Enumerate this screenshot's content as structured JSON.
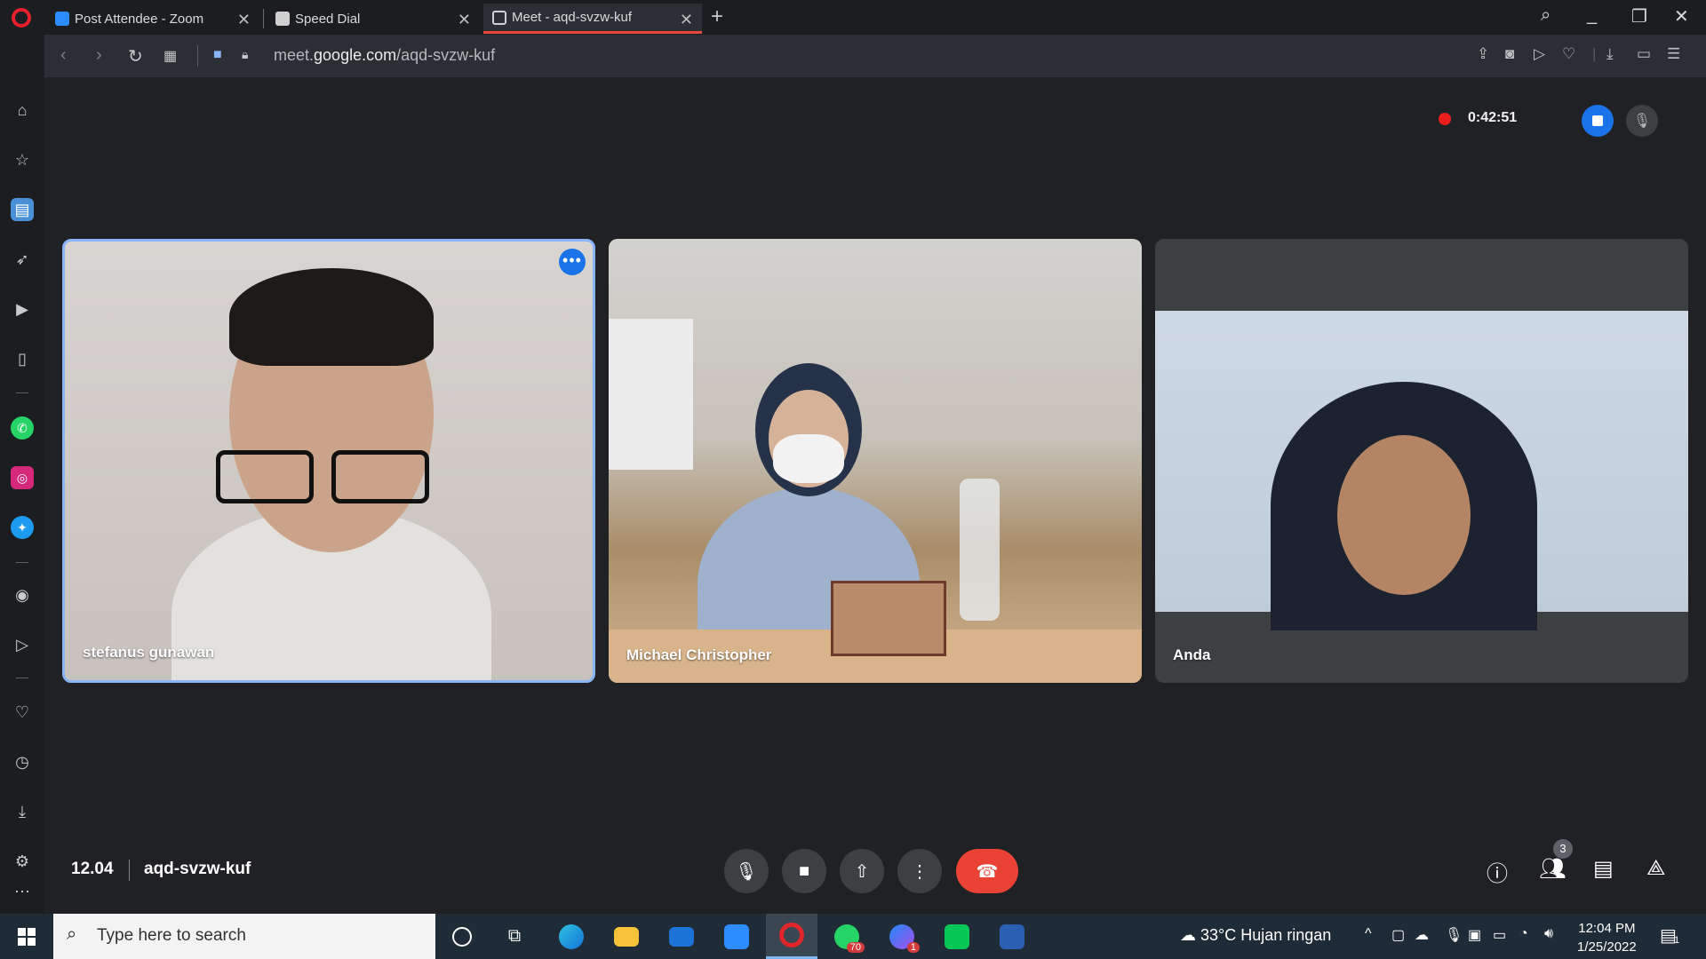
{
  "browser": {
    "tabs": [
      {
        "label": "Post Attendee - Zoom",
        "active": false
      },
      {
        "label": "Speed Dial",
        "active": false
      },
      {
        "label": "Meet - aqd-svzw-kuf",
        "active": true
      }
    ],
    "url_prefix": "meet.",
    "url_domain": "google.com",
    "url_path": "/aqd-svzw-kuf",
    "accent_color": "#e8473f"
  },
  "sidebar": {
    "icons": [
      "home-icon",
      "star-icon",
      "workspace-icon",
      "rocket-icon",
      "player-icon",
      "reader-icon",
      "whatsapp-icon",
      "instagram-icon",
      "twitter-icon",
      "video-icon",
      "send-icon",
      "heart-icon",
      "history-icon",
      "download-icon",
      "settings-icon",
      "more-icon"
    ]
  },
  "recording": {
    "elapsed": "0:42:51"
  },
  "participants": [
    {
      "name": "stefanus gunawan",
      "active_speaker": true
    },
    {
      "name": "Michael Christopher",
      "active_speaker": false
    },
    {
      "name": "Anda",
      "active_speaker": false
    }
  ],
  "meeting": {
    "time": "12.04",
    "code": "aqd-svzw-kuf",
    "people_count": "3",
    "end_call_color": "#ea4335"
  },
  "taskbar": {
    "search_placeholder": "Type here to search",
    "whatsapp_badge": "70",
    "messenger_badge": "1",
    "temperature": "33°C",
    "weather": "Hujan ringan",
    "time": "12:04 PM",
    "date": "1/25/2022",
    "notification_count": "1"
  }
}
